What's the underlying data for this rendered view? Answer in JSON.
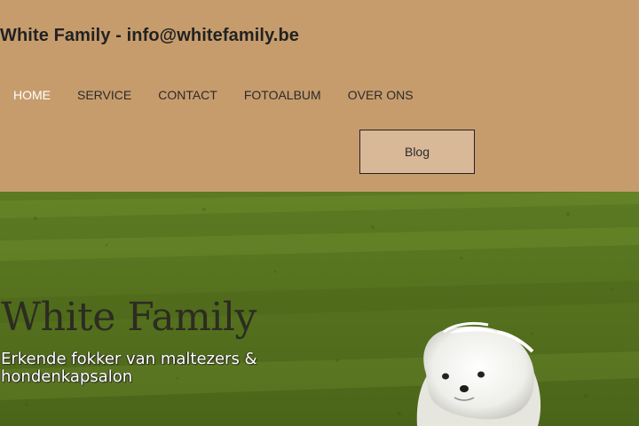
{
  "header": {
    "site_title": "White Family - info@whitefamily.be"
  },
  "nav": {
    "items": [
      {
        "label": "HOME",
        "active": true
      },
      {
        "label": "SERVICE",
        "active": false
      },
      {
        "label": "CONTACT",
        "active": false
      },
      {
        "label": "FOTOALBUM",
        "active": false
      },
      {
        "label": "OVER ONS",
        "active": false
      }
    ],
    "blog_label": "Blog"
  },
  "hero": {
    "title": "White Family",
    "subtitle": "Erkende fokker van maltezers & hondenkapsalon",
    "image": "maltese-dog-on-grass"
  },
  "colors": {
    "header_bg": "#c69c6d",
    "blog_button_bg": "#d9b898",
    "active_nav": "#ffffff",
    "grass": "#55701f"
  }
}
